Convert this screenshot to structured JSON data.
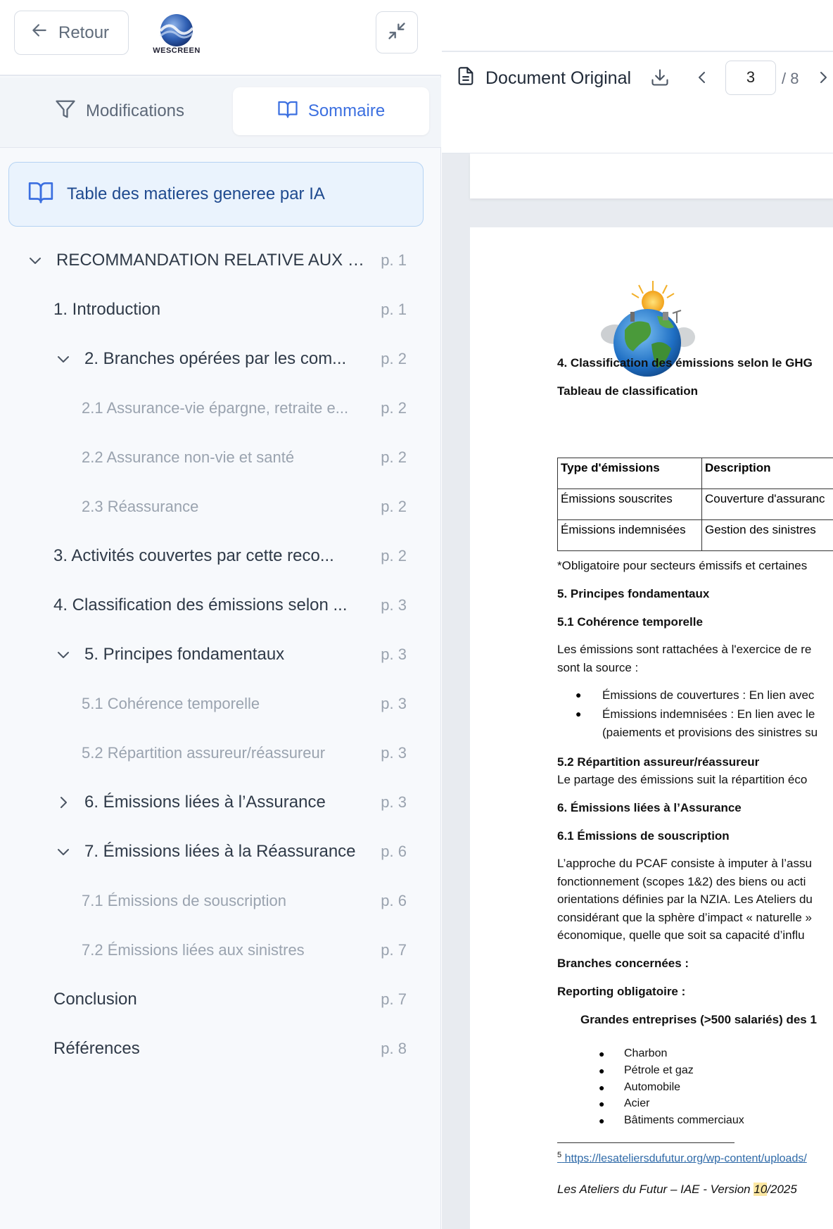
{
  "sidebar": {
    "back_label": "Retour",
    "logo_text": "WESCREEN",
    "tabs": [
      {
        "label": "Modifications",
        "active": false
      },
      {
        "label": "Sommaire",
        "active": true
      }
    ],
    "ai_banner": "Table des matieres generee par IA",
    "toc": [
      {
        "label": "RECOMMANDATION RELATIVE AUX É...",
        "page": "p. 1",
        "level": 0,
        "chevron": "down"
      },
      {
        "label": "1. Introduction",
        "page": "p. 1",
        "level": 1,
        "chevron": ""
      },
      {
        "label": "2. Branches opérées par les com...",
        "page": "p. 2",
        "level": 1,
        "chevron": "down"
      },
      {
        "label": "2.1 Assurance-vie épargne, retraite e...",
        "page": "p. 2",
        "level": 2,
        "chevron": ""
      },
      {
        "label": "2.2 Assurance non-vie et santé",
        "page": "p. 2",
        "level": 2,
        "chevron": ""
      },
      {
        "label": "2.3 Réassurance",
        "page": "p. 2",
        "level": 2,
        "chevron": ""
      },
      {
        "label": "3. Activités couvertes par cette reco...",
        "page": "p. 2",
        "level": 1,
        "chevron": ""
      },
      {
        "label": "4. Classification des émissions selon ...",
        "page": "p. 3",
        "level": 1,
        "chevron": ""
      },
      {
        "label": "5. Principes fondamentaux",
        "page": "p. 3",
        "level": 1,
        "chevron": "down"
      },
      {
        "label": "5.1 Cohérence temporelle",
        "page": "p. 3",
        "level": 2,
        "chevron": ""
      },
      {
        "label": "5.2 Répartition assureur/réassureur",
        "page": "p. 3",
        "level": 2,
        "chevron": ""
      },
      {
        "label": "6. Émissions liées à l’Assurance",
        "page": "p. 3",
        "level": 1,
        "chevron": "right"
      },
      {
        "label": "7. Émissions liées à la Réassurance",
        "page": "p. 6",
        "level": 1,
        "chevron": "down"
      },
      {
        "label": "7.1 Émissions de souscription",
        "page": "p. 6",
        "level": 2,
        "chevron": ""
      },
      {
        "label": "7.2 Émissions liées aux sinistres",
        "page": "p. 7",
        "level": 2,
        "chevron": ""
      },
      {
        "label": "Conclusion",
        "page": "p. 7",
        "level": 1,
        "chevron": ""
      },
      {
        "label": "Références",
        "page": "p. 8",
        "level": 1,
        "chevron": ""
      }
    ]
  },
  "viewer": {
    "title": "Document Original",
    "current_page": "3",
    "total_pages": "/ 8"
  },
  "document": {
    "h_classification": "4. Classification des émissions selon le GHG",
    "h_tableau": "Tableau de classification",
    "table_header": [
      "Type d'émissions",
      "Description"
    ],
    "table_rows": [
      [
        "Émissions souscrites",
        "Couverture d'assuranc"
      ],
      [
        "Émissions indemnisées",
        "Gestion des sinistres"
      ]
    ],
    "table_note": "*Obligatoire pour secteurs émissifs et certaines",
    "h_principes": "5. Principes fondamentaux",
    "h_coherence": "5.1 Cohérence temporelle",
    "p_coherence_1": "Les émissions sont rattachées à l'exercice de re",
    "p_coherence_2": "sont la source :",
    "bullet_1": "Émissions de couvertures : En lien avec",
    "bullet_2": "Émissions indemnisées : En lien avec le",
    "bullet_2b": "(paiements et provisions des sinistres su",
    "h_repartition": "5.2 Répartition assureur/réassureur",
    "p_repartition": "Le partage des émissions suit la répartition éco",
    "h_assurance": "6. Émissions liées à l’Assurance",
    "h_souscription": "6.1 Émissions de souscription",
    "p_pcaf": [
      "L’approche du PCAF consiste à imputer à l’assu",
      "fonctionnement (scopes 1&2) des biens ou acti",
      "orientations définies par la NZIA. Les Ateliers du",
      "considérant que la sphère d’impact « naturelle »",
      "économique, quelle que soit sa capacité d’influ"
    ],
    "h_branches": "Branches concernées :",
    "h_reporting": "Reporting obligatoire :",
    "h_grandes": "Grandes entreprises (>500 salariés) des 1",
    "sectors": [
      "Charbon",
      "Pétrole et gaz",
      "Automobile",
      "Acier",
      "Bâtiments commerciaux"
    ],
    "footnote": "https://lesateliersdufutur.org/wp-content/uploads/",
    "footnote_num": "5",
    "footer_pre": "Les Ateliers du Futur – IAE - Version ",
    "footer_hl": "10",
    "footer_post": "/2025"
  }
}
